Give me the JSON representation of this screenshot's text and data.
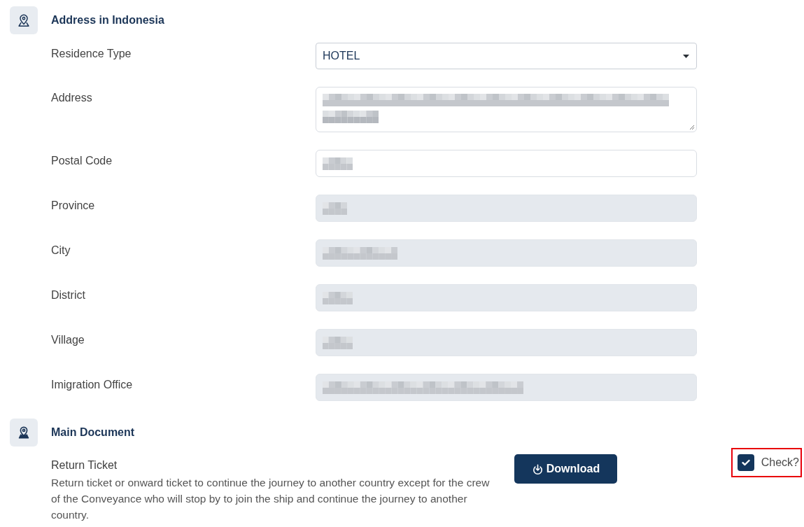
{
  "sections": [
    {
      "kind": "address",
      "title": "Address in Indonesia",
      "fields": [
        {
          "label": "Residence Type",
          "kind": "select",
          "value": "HOTEL",
          "disabled": false
        },
        {
          "label": "Address",
          "kind": "textarea",
          "redacted": true,
          "disabled": false
        },
        {
          "label": "Postal Code",
          "kind": "text",
          "redacted": true,
          "disabled": false
        },
        {
          "label": "Province",
          "kind": "text",
          "redacted": true,
          "disabled": true
        },
        {
          "label": "City",
          "kind": "text",
          "redacted": true,
          "disabled": true
        },
        {
          "label": "District",
          "kind": "text",
          "redacted": true,
          "disabled": true
        },
        {
          "label": "Village",
          "kind": "text",
          "redacted": true,
          "disabled": true
        },
        {
          "label": "Imigration Office",
          "kind": "text",
          "redacted": true,
          "disabled": true
        }
      ]
    },
    {
      "kind": "documents",
      "title": "Main Document",
      "documents": [
        {
          "title": "Return Ticket",
          "description": "Return ticket or onward ticket to continue the journey to another country except for the crew of the Conveyance who will stop by to join the ship and continue the journey to another country.",
          "button": "Download",
          "check": {
            "label": "Check?",
            "checked": true,
            "highlighted": true
          }
        }
      ]
    }
  ]
}
